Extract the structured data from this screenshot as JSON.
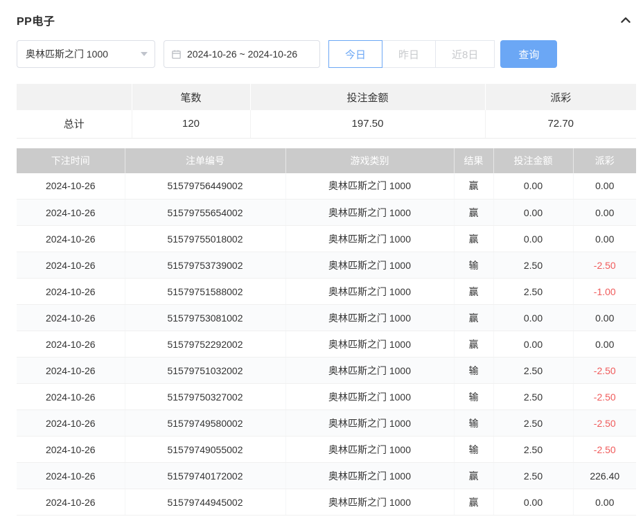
{
  "panel": {
    "title": "PP电子"
  },
  "filters": {
    "game_select": {
      "value": "奥林匹斯之门 1000"
    },
    "date_range": {
      "value": "2024-10-26 ~ 2024-10-26"
    },
    "quick_buttons": [
      {
        "label": "今日",
        "active": true
      },
      {
        "label": "昨日",
        "active": false
      },
      {
        "label": "近8日",
        "active": false
      }
    ],
    "query_label": "查询"
  },
  "summary": {
    "columns": [
      "",
      "笔数",
      "投注金额",
      "派彩"
    ],
    "total": {
      "label": "总计",
      "count": "120",
      "bet_amount": "197.50",
      "payout": "72.70"
    }
  },
  "table": {
    "columns": [
      "下注时间",
      "注单编号",
      "游戏类别",
      "结果",
      "投注金额",
      "派彩"
    ],
    "rows": [
      {
        "time": "2024-10-26",
        "order_id": "51579756449002",
        "game": "奥林匹斯之门 1000",
        "result": "赢",
        "bet": "0.00",
        "payout": "0.00",
        "negative": false
      },
      {
        "time": "2024-10-26",
        "order_id": "51579755654002",
        "game": "奥林匹斯之门 1000",
        "result": "赢",
        "bet": "0.00",
        "payout": "0.00",
        "negative": false
      },
      {
        "time": "2024-10-26",
        "order_id": "51579755018002",
        "game": "奥林匹斯之门 1000",
        "result": "赢",
        "bet": "0.00",
        "payout": "0.00",
        "negative": false
      },
      {
        "time": "2024-10-26",
        "order_id": "51579753739002",
        "game": "奥林匹斯之门 1000",
        "result": "输",
        "bet": "2.50",
        "payout": "-2.50",
        "negative": true
      },
      {
        "time": "2024-10-26",
        "order_id": "51579751588002",
        "game": "奥林匹斯之门 1000",
        "result": "赢",
        "bet": "2.50",
        "payout": "-1.00",
        "negative": true
      },
      {
        "time": "2024-10-26",
        "order_id": "51579753081002",
        "game": "奥林匹斯之门 1000",
        "result": "赢",
        "bet": "0.00",
        "payout": "0.00",
        "negative": false
      },
      {
        "time": "2024-10-26",
        "order_id": "51579752292002",
        "game": "奥林匹斯之门 1000",
        "result": "赢",
        "bet": "0.00",
        "payout": "0.00",
        "negative": false
      },
      {
        "time": "2024-10-26",
        "order_id": "51579751032002",
        "game": "奥林匹斯之门 1000",
        "result": "输",
        "bet": "2.50",
        "payout": "-2.50",
        "negative": true
      },
      {
        "time": "2024-10-26",
        "order_id": "51579750327002",
        "game": "奥林匹斯之门 1000",
        "result": "输",
        "bet": "2.50",
        "payout": "-2.50",
        "negative": true
      },
      {
        "time": "2024-10-26",
        "order_id": "51579749580002",
        "game": "奥林匹斯之门 1000",
        "result": "输",
        "bet": "2.50",
        "payout": "-2.50",
        "negative": true
      },
      {
        "time": "2024-10-26",
        "order_id": "51579749055002",
        "game": "奥林匹斯之门 1000",
        "result": "输",
        "bet": "2.50",
        "payout": "-2.50",
        "negative": true
      },
      {
        "time": "2024-10-26",
        "order_id": "51579740172002",
        "game": "奥林匹斯之门 1000",
        "result": "赢",
        "bet": "2.50",
        "payout": "226.40",
        "negative": false
      },
      {
        "time": "2024-10-26",
        "order_id": "51579744945002",
        "game": "奥林匹斯之门 1000",
        "result": "赢",
        "bet": "0.00",
        "payout": "0.00",
        "negative": false
      }
    ]
  },
  "colors": {
    "accent_blue": "#6ba7f5",
    "negative_red": "#f05b5b",
    "detail_header_bg": "#cbcbcb",
    "summary_header_bg": "#f2f2f2"
  }
}
